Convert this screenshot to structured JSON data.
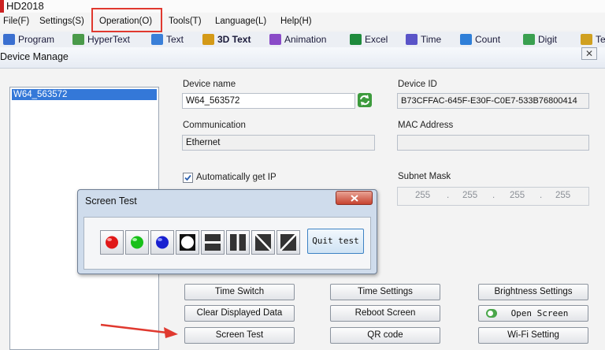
{
  "window": {
    "title": "HD2018"
  },
  "menu": [
    {
      "id": "file",
      "label": "File(F)"
    },
    {
      "id": "settings",
      "label": "Settings(S)"
    },
    {
      "id": "operation",
      "label": "Operation(O)"
    },
    {
      "id": "tools",
      "label": "Tools(T)"
    },
    {
      "id": "language",
      "label": "Language(L)"
    },
    {
      "id": "help",
      "label": "Help(H)"
    }
  ],
  "toolbar": [
    {
      "id": "program",
      "label": "Program",
      "icon": "program-icon",
      "color": "#3a6fd0"
    },
    {
      "id": "hypertext",
      "label": "HyperText",
      "icon": "hypertext-icon",
      "color": "#4a9a4a"
    },
    {
      "id": "text",
      "label": "Text",
      "icon": "text-icon",
      "color": "#3a7fd8"
    },
    {
      "id": "3dtext",
      "label": "3D Text",
      "icon": "3d-text-icon",
      "color": "#d49a18"
    },
    {
      "id": "animation",
      "label": "Animation",
      "icon": "animation-icon",
      "color": "#8a4bc8"
    },
    {
      "id": "excel",
      "label": "Excel",
      "icon": "excel-icon",
      "color": "#1e8a3c"
    },
    {
      "id": "time",
      "label": "Time",
      "icon": "time-icon",
      "color": "#5a54c8"
    },
    {
      "id": "count",
      "label": "Count",
      "icon": "count-icon",
      "color": "#2f7fd8"
    },
    {
      "id": "digit",
      "label": "Digit",
      "icon": "digit-icon",
      "color": "#3aa050"
    },
    {
      "id": "te",
      "label": "Te",
      "icon": "te-icon",
      "color": "#d0a020"
    }
  ],
  "device_manage": {
    "title": "Device Manage",
    "close_glyph": "✕",
    "devices": [
      "W64_563572"
    ],
    "labels": {
      "device_name": "Device name",
      "device_id": "Device ID",
      "communication": "Communication",
      "mac_address": "MAC Address",
      "auto_ip": "Automatically get IP",
      "subnet_mask": "Subnet Mask"
    },
    "values": {
      "device_name": "W64_563572",
      "device_id": "B73CFFAC-645F-E30F-C0E7-533B76800414",
      "communication": "Ethernet",
      "mac_address": "",
      "auto_ip_checked": true,
      "subnet_mask": [
        "255",
        "255",
        "255",
        "255"
      ]
    },
    "buttons": {
      "time_switch": "Time Switch",
      "time_settings": "Time Settings",
      "brightness_settings": "Brightness Settings",
      "clear_displayed_data": "Clear Displayed Data",
      "reboot_screen": "Reboot Screen",
      "open_screen": "Open Screen",
      "screen_test": "Screen Test",
      "qr_code": "QR code",
      "wifi_setting": "Wi-Fi Setting"
    }
  },
  "screen_test_dialog": {
    "title": "Screen Test",
    "quit_label": "Quit test",
    "tests": [
      {
        "id": "red",
        "icon": "red-dot-icon",
        "color": "#e01818"
      },
      {
        "id": "green",
        "icon": "green-dot-icon",
        "color": "#18c018"
      },
      {
        "id": "blue",
        "icon": "blue-dot-icon",
        "color": "#1820d0"
      },
      {
        "id": "circle",
        "icon": "white-circle-icon",
        "color": "#ffffff"
      },
      {
        "id": "horizontal",
        "icon": "horizontal-bar-icon",
        "color": "#333333"
      },
      {
        "id": "vertical",
        "icon": "vertical-bar-icon",
        "color": "#333333"
      },
      {
        "id": "diagonal-left",
        "icon": "diagonal-left-icon",
        "color": "#333333"
      },
      {
        "id": "diagonal-right",
        "icon": "diagonal-right-icon",
        "color": "#333333"
      }
    ]
  },
  "annotation": {
    "highlight_color": "#e0392f",
    "arrow_color": "#e0392f"
  }
}
